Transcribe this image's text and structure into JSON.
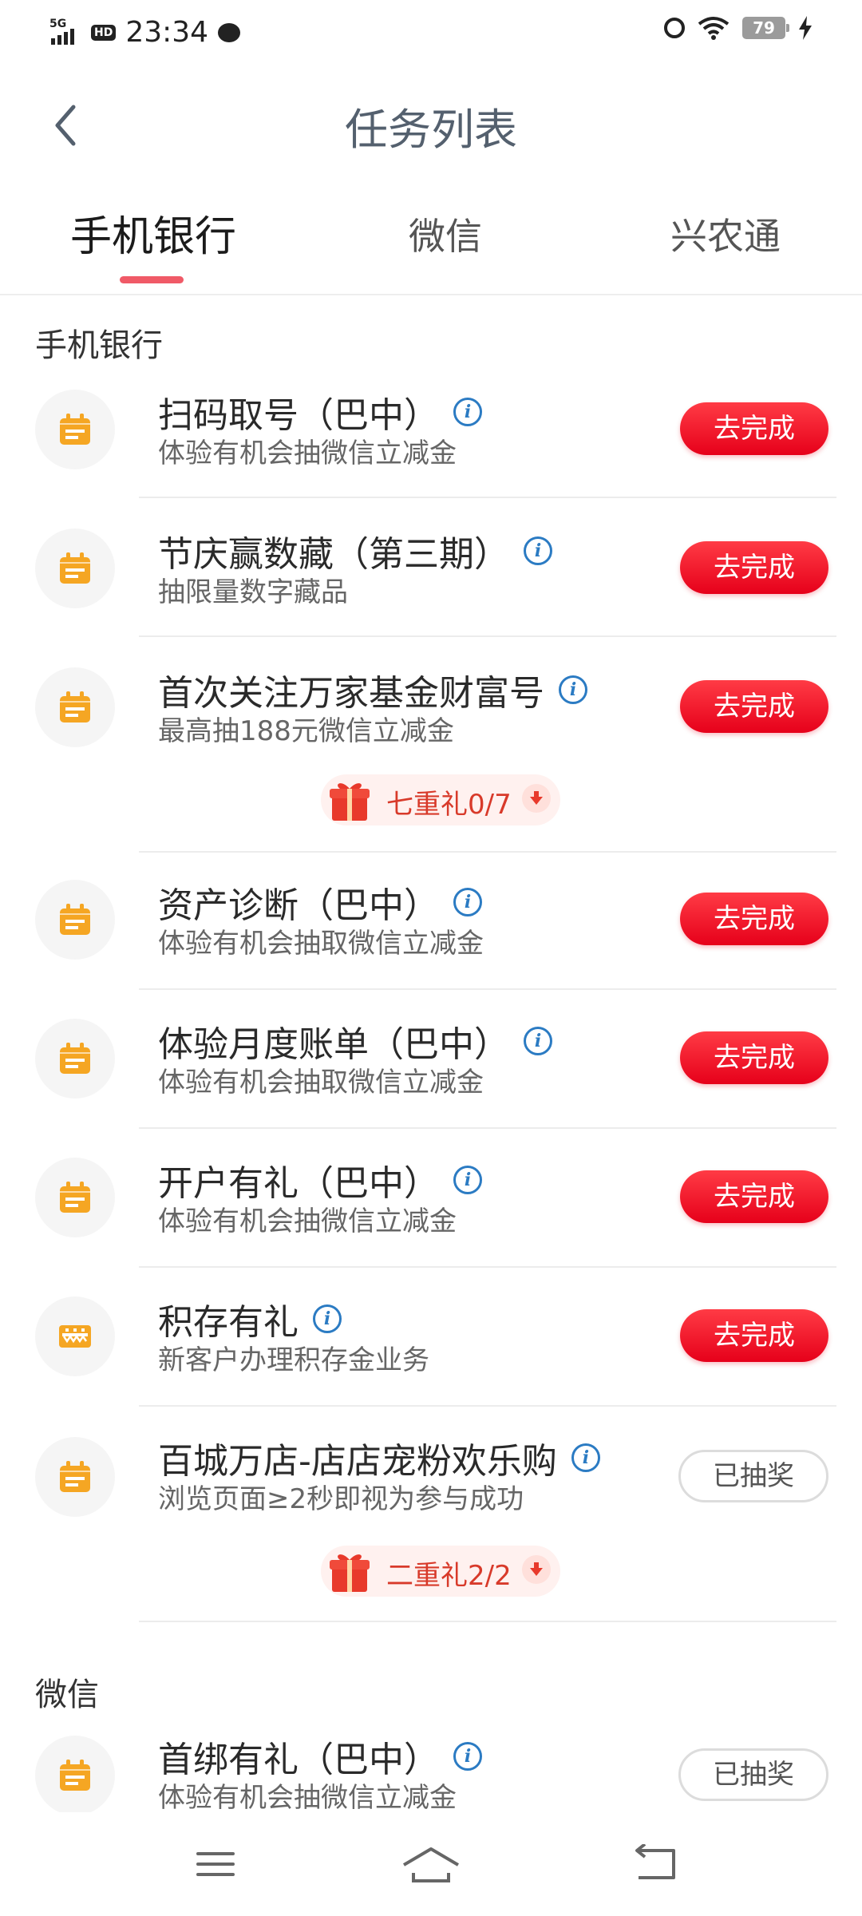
{
  "status_bar": {
    "network": "5G",
    "hd": "HD",
    "time": "23:34",
    "battery": "79"
  },
  "header": {
    "title": "任务列表"
  },
  "tabs": [
    {
      "label": "手机银行"
    },
    {
      "label": "微信"
    },
    {
      "label": "兴农通"
    }
  ],
  "sections": [
    {
      "title": "手机银行"
    },
    {
      "title": "微信"
    }
  ],
  "tasks": [
    {
      "name": "扫码取号（巴中）",
      "desc": "体验有机会抽微信立减金",
      "button": "去完成"
    },
    {
      "name": "节庆赢数藏（第三期）",
      "desc": "抽限量数字藏品",
      "button": "去完成"
    },
    {
      "name": "首次关注万家基金财富号",
      "desc": "最高抽188元微信立减金",
      "button": "去完成",
      "gift": "七重礼0/7"
    },
    {
      "name": "资产诊断（巴中）",
      "desc": "体验有机会抽取微信立减金",
      "button": "去完成"
    },
    {
      "name": "体验月度账单（巴中）",
      "desc": "体验有机会抽取微信立减金",
      "button": "去完成"
    },
    {
      "name": "开户有礼（巴中）",
      "desc": "体验有机会抽微信立减金",
      "button": "去完成"
    },
    {
      "name": "积存有礼",
      "desc": "新客户办理积存金业务",
      "button": "去完成"
    },
    {
      "name": "百城万店-店店宠粉欢乐购",
      "desc": "浏览页面≥2秒即视为参与成功",
      "button": "已抽奖",
      "gift": "二重礼2/2"
    },
    {
      "name": "首绑有礼（巴中）",
      "desc": "体验有机会抽微信立减金",
      "button": "已抽奖"
    }
  ],
  "info_glyph": "i",
  "colors": {
    "accent_red": "#e6001a",
    "tab_indicator": "#f05a67",
    "icon_orange": "#f5a623",
    "info_blue": "#2b7bc3"
  }
}
